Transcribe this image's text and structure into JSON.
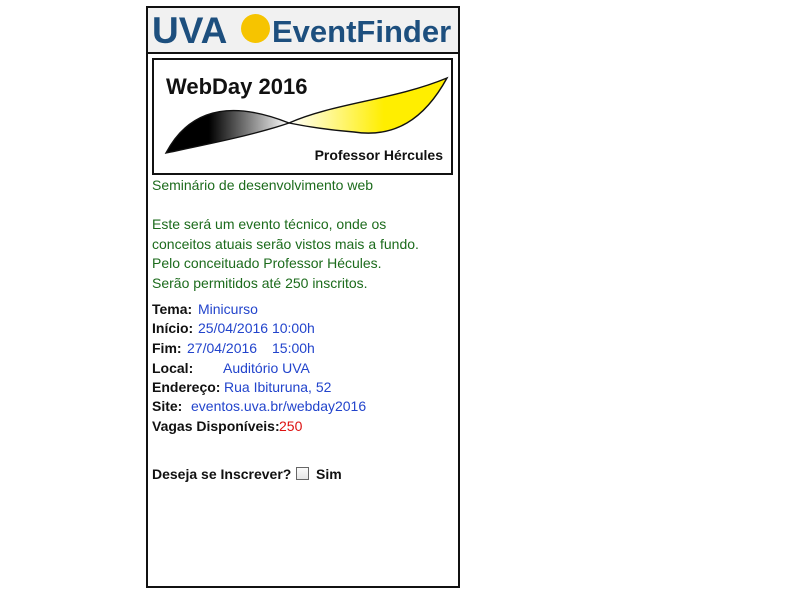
{
  "header": {
    "logo_part1": "UVA",
    "logo_part2": "EventFinder",
    "colors": {
      "logo_text": "#1d4f7e",
      "logo_sun": "#f6c400"
    }
  },
  "banner": {
    "title": "WebDay 2016",
    "subtitle": "Professor Hércules"
  },
  "description": {
    "subtitle": "Seminário de desenvolvimento web",
    "lines": [
      "Este será um evento técnico, onde os",
      "conceitos atuais serão vistos mais a fundo.",
      "Pelo conceituado Professor Hécules.",
      "Serão permitidos até 250 inscritos."
    ],
    "color": "#1c6b1c"
  },
  "details": {
    "tema": {
      "label": "Tema:",
      "value": "Minicurso"
    },
    "inicio": {
      "label": "Início:",
      "value": "25/04/2016 10:00h"
    },
    "fim": {
      "label": "Fim:",
      "date": "27/04/2016",
      "time": "15:00h"
    },
    "local": {
      "label": "Local:",
      "value": "Auditório UVA"
    },
    "endereco": {
      "label": "Endereço:",
      "value": "Rua Ibituruna, 52"
    },
    "site": {
      "label": "Site:",
      "value": "eventos.uva.br/webday2016"
    },
    "vagas": {
      "label": "Vagas Disponíveis:",
      "value": "250"
    },
    "colors": {
      "value": "#2244cc",
      "vagas_value": "#d11111"
    }
  },
  "subscribe": {
    "question": "Deseja se Inscrever?",
    "option_label": "Sim",
    "checked": false
  }
}
